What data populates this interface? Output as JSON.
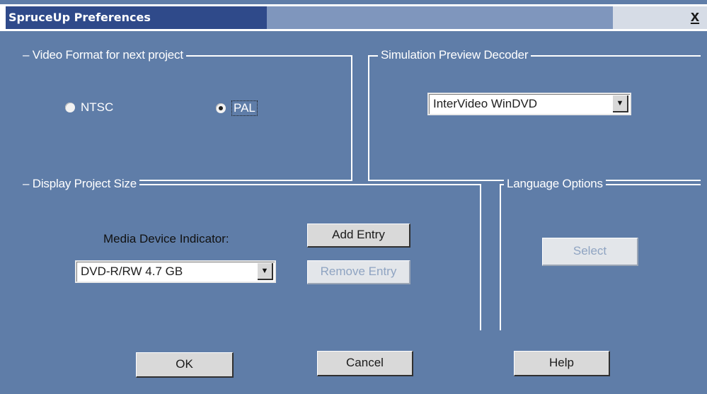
{
  "window": {
    "title": "SpruceUp Preferences",
    "close_label": "x"
  },
  "video_format": {
    "group_label": "Video Format for next project",
    "options": [
      {
        "label": "NTSC",
        "selected": false
      },
      {
        "label": "PAL",
        "selected": true
      }
    ]
  },
  "decoder": {
    "group_label": "Simulation Preview Decoder",
    "selected": "InterVideo WinDVD"
  },
  "project_size": {
    "group_label": "Display Project Size",
    "media_label": "Media Device Indicator:",
    "media_selected": "DVD-R/RW 4.7 GB",
    "add_entry_label": "Add Entry",
    "remove_entry_label": "Remove Entry"
  },
  "language": {
    "group_label": "Language Options",
    "select_label": "Select"
  },
  "footer": {
    "ok_label": "OK",
    "cancel_label": "Cancel",
    "help_label": "Help"
  }
}
